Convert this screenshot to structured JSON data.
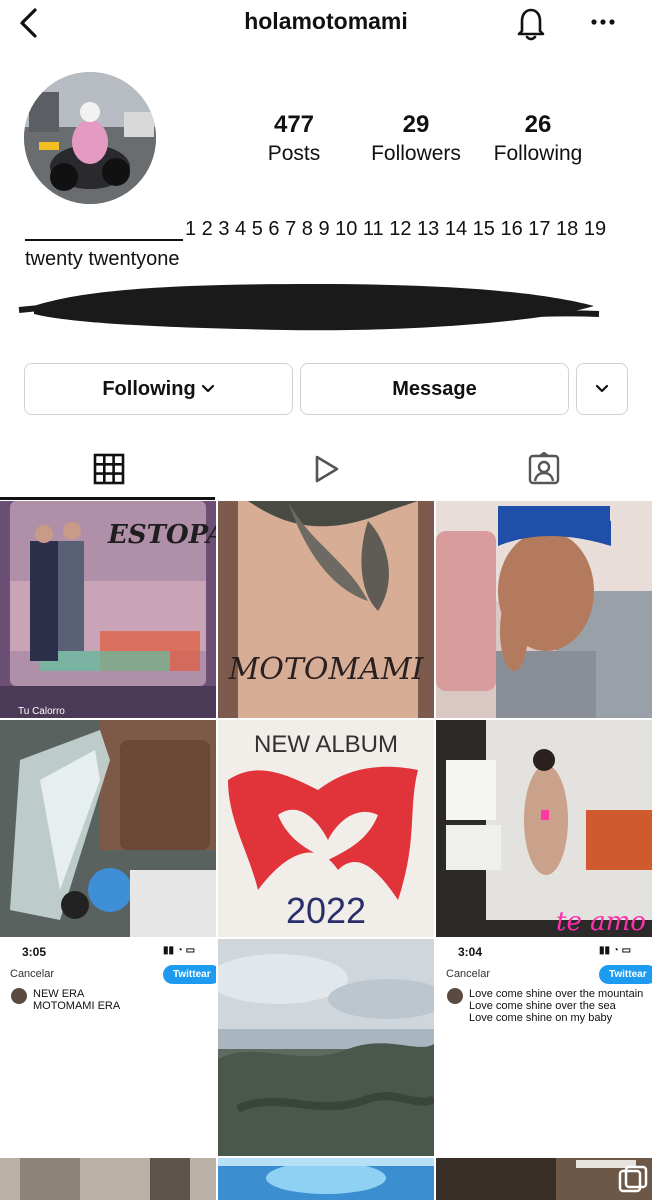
{
  "header": {
    "username": "holamotomami",
    "back_icon": "chevron-left-icon",
    "notification_icon": "bell-icon",
    "more_icon": "more-horizontal-icon"
  },
  "stats": [
    {
      "value": "477",
      "label": "Posts"
    },
    {
      "value": "29",
      "label": "Followers"
    },
    {
      "value": "26",
      "label": "Following"
    }
  ],
  "bio": {
    "line1": "1 2 3 4 5 6 7 8 9 10 11 12 13 14 15 16 17 18 19",
    "line2": "twenty twentyone"
  },
  "buttons": {
    "following": "Following",
    "message": "Message"
  },
  "tabs": [
    "grid-icon",
    "reels-icon",
    "tagged-icon"
  ],
  "posts": {
    "p1_caption": "Tu Calorro",
    "p1_logo": "ESTOPA",
    "p2_text": "MOTOMAMI",
    "p5_top": "NEW ALBUM",
    "p5_bottom": "2022",
    "p6_text": "te amo",
    "tw1": {
      "time": "3:05",
      "cancel": "Cancelar",
      "button": "Twittear",
      "text": "NEW ERA\nMOTOMAMI ERA"
    },
    "tw2": {
      "time": "3:04",
      "cancel": "Cancelar",
      "button": "Twittear",
      "text": "Love come shine over the mountain\nLove come shine over the sea\nLove come shine on my baby"
    }
  },
  "colors": {
    "accent": "#1d9bf0",
    "border": "#d2d2d2",
    "text": "#111111"
  }
}
